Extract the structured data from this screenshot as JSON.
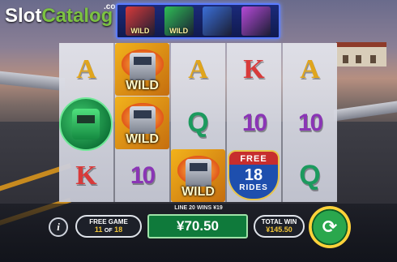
{
  "logo": {
    "slot": "Slot",
    "catalog": "Catalog",
    "com": ".com"
  },
  "topbar": {
    "wilds": [
      {
        "label": "WILD",
        "color": "#d83a3a"
      },
      {
        "label": "WILD",
        "color": "#2fbf56"
      },
      {
        "label": "",
        "color": "#3b6fd8"
      },
      {
        "label": "",
        "color": "#b64ad8"
      }
    ]
  },
  "reels": [
    [
      "A",
      "",
      "K"
    ],
    [
      "WILD",
      "WILD",
      "10"
    ],
    [
      "A",
      "Q",
      "WILD"
    ],
    [
      "K",
      "10",
      "FREE 18 RIDES"
    ],
    [
      "A",
      "10",
      "Q"
    ]
  ],
  "free_badge": {
    "line1": "FREE",
    "line2": "18",
    "line3": "RIDES"
  },
  "line_info": "LINE 20 WINS ¥19",
  "free_game": {
    "label": "FREE GAME",
    "current": "11",
    "of": "OF",
    "total": "18"
  },
  "win_amount": "¥70.50",
  "total_win": {
    "label": "TOTAL WIN",
    "value": "¥145.50"
  },
  "info_icon": "i",
  "spin_icon": "⟳"
}
